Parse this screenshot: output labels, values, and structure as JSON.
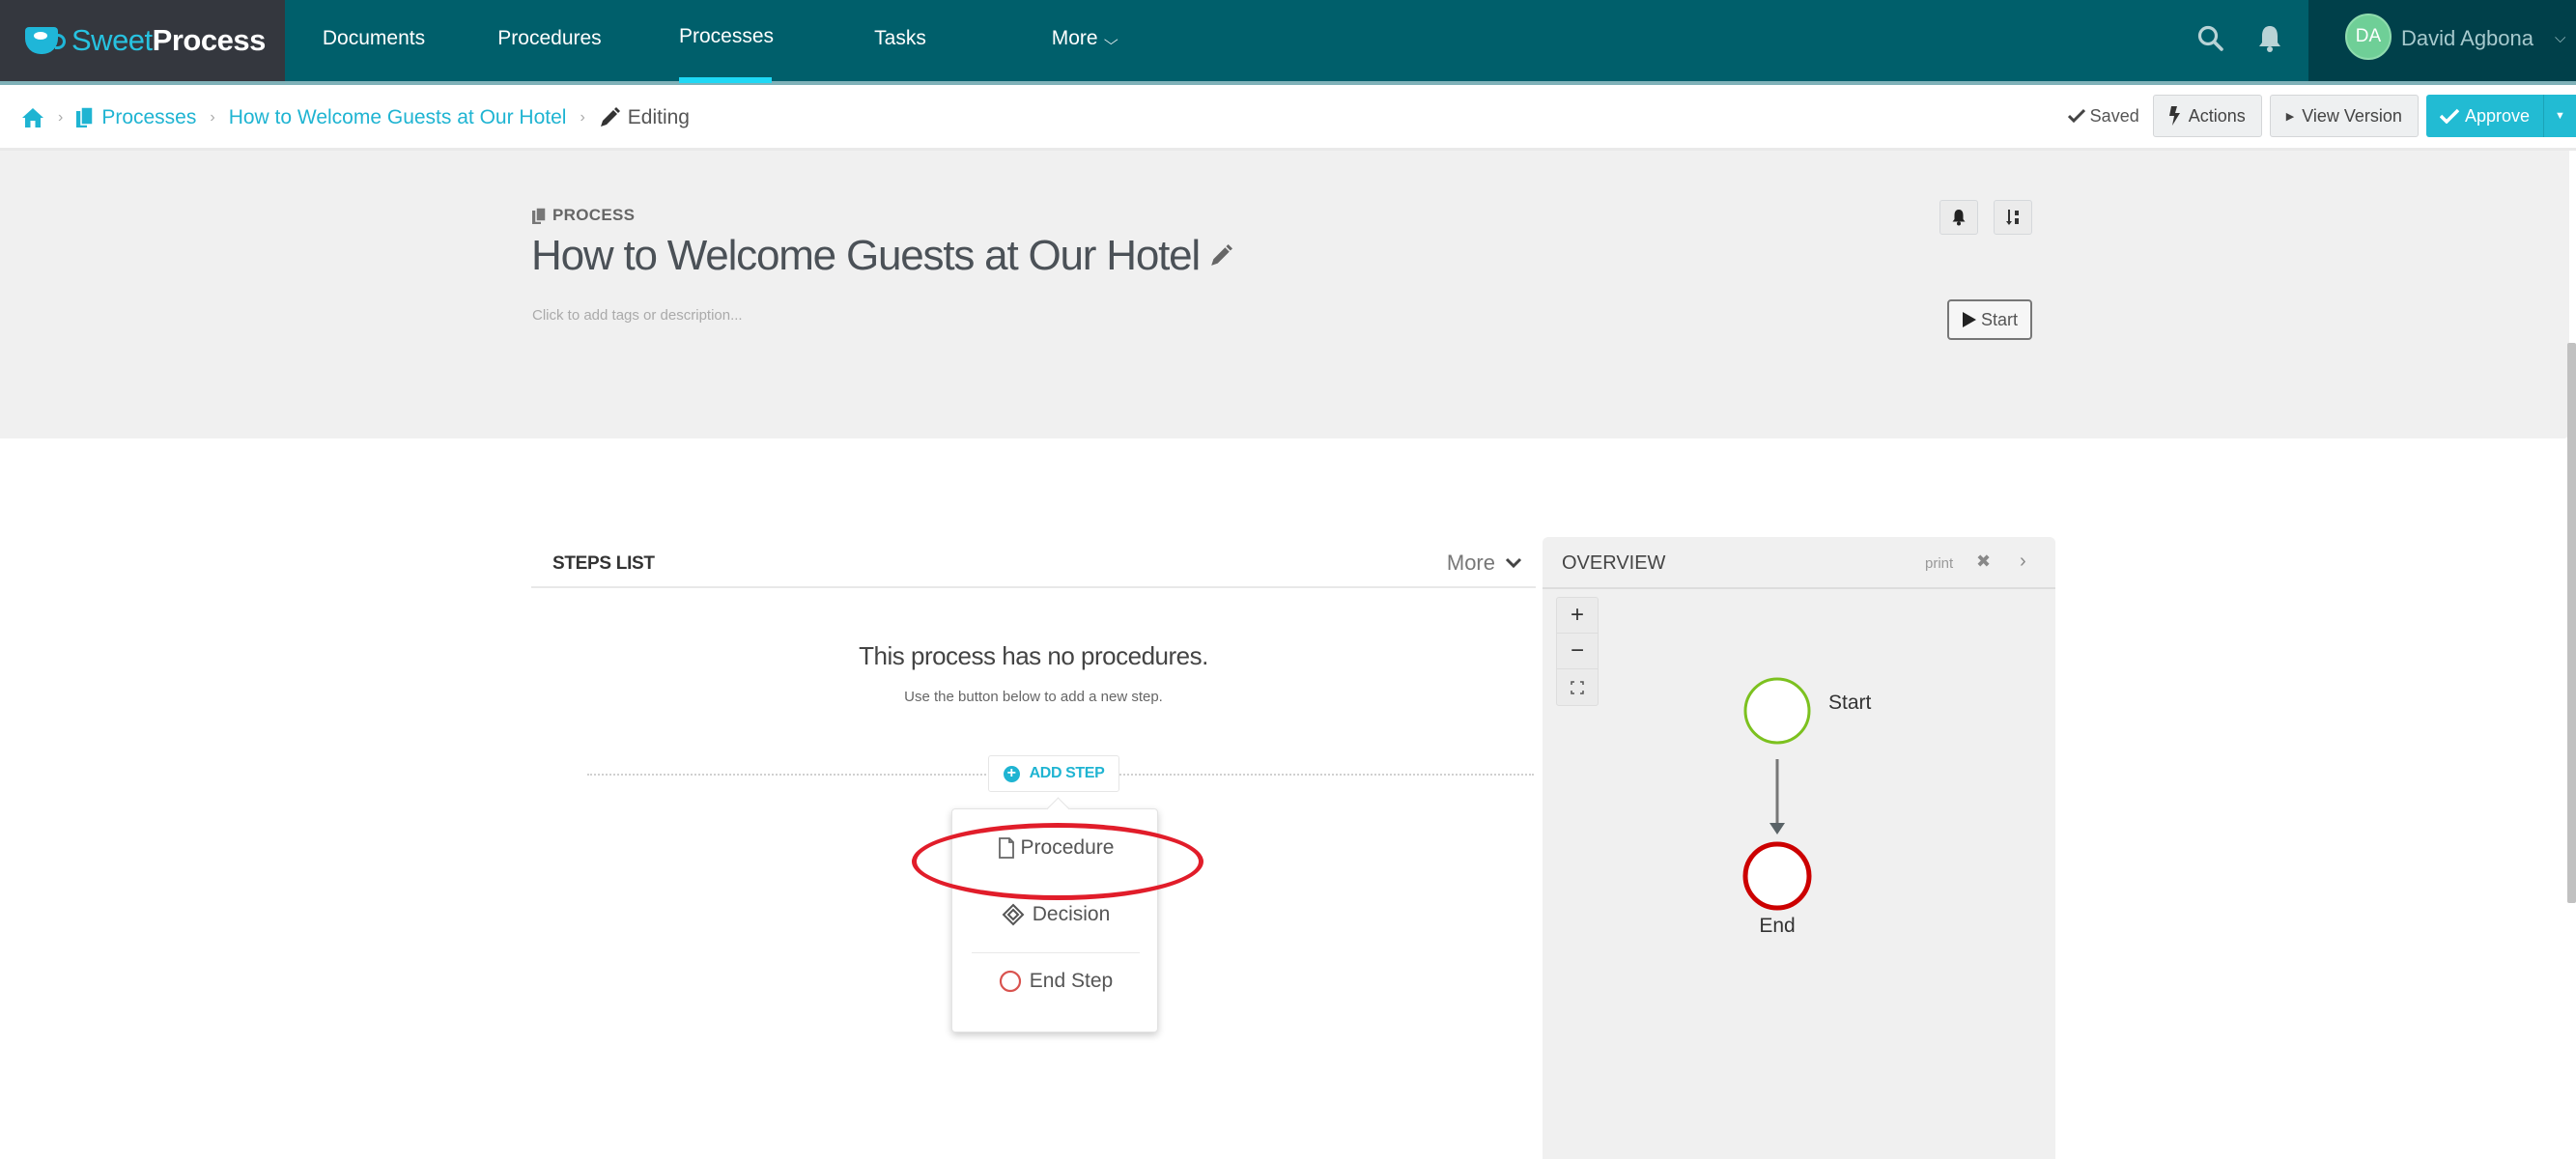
{
  "brand": {
    "part1": "Sweet",
    "part2": "Process"
  },
  "nav": {
    "items": [
      {
        "label": "Documents",
        "active": false
      },
      {
        "label": "Procedures",
        "active": false
      },
      {
        "label": "Processes",
        "active": true
      },
      {
        "label": "Tasks",
        "active": false
      },
      {
        "label": "More",
        "active": false
      }
    ],
    "search_icon": "search-icon",
    "bell_icon": "bell-icon"
  },
  "user": {
    "initials": "DA",
    "name": "David Agbona",
    "avatar_color": "#6fcf97"
  },
  "breadcrumb": {
    "home_icon": "home-icon",
    "items": [
      {
        "label": "Processes",
        "icon": "copy-icon"
      },
      {
        "label": "How to Welcome Guests at Our Hotel"
      },
      {
        "label": "Editing",
        "icon": "pencil-icon"
      }
    ]
  },
  "toolbar": {
    "status": "Saved",
    "actions_label": "Actions",
    "view_version_label": "View Version",
    "approve_label": "Approve"
  },
  "page_header": {
    "kind": "PROCESS",
    "title": "How to Welcome Guests at Our Hotel",
    "description_placeholder": "Click to add tags or description...",
    "start_label": "Start"
  },
  "steps_list": {
    "title": "STEPS LIST",
    "more_label": "More",
    "empty_title": "This process has no procedures.",
    "empty_subtitle": "Use the button below to add a new step.",
    "add_step_label": "ADD STEP",
    "menu": [
      {
        "label": "Procedure",
        "icon": "file-icon",
        "highlighted": true
      },
      {
        "label": "Decision",
        "icon": "decision-icon"
      },
      {
        "label": "End Step",
        "icon": "end-circle-icon"
      }
    ]
  },
  "overview": {
    "title": "OVERVIEW",
    "print_label": "print",
    "zoom_in": "+",
    "zoom_out": "−",
    "nodes": [
      {
        "label": "Start",
        "color": "#7cc11f"
      },
      {
        "label": "End",
        "color": "#cc0000"
      }
    ]
  },
  "colors": {
    "nav_bg": "#005f6b",
    "logo_bg": "#34373e",
    "user_bg": "#00404a",
    "accent": "#1fb4d2",
    "approve": "#22bbd3",
    "highlight": "#e11d2a"
  }
}
